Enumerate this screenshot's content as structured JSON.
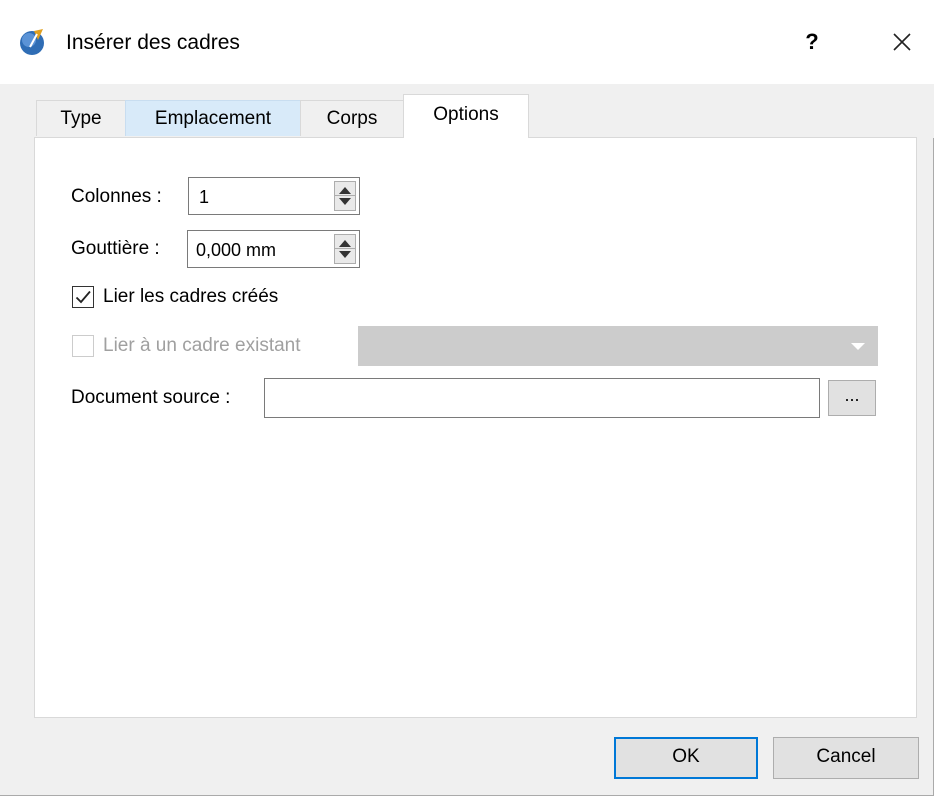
{
  "window": {
    "title": "Insérer des cadres",
    "help_label": "?"
  },
  "tabs": [
    {
      "label": "Type",
      "state": "normal"
    },
    {
      "label": "Emplacement",
      "state": "hover"
    },
    {
      "label": "Corps",
      "state": "normal"
    },
    {
      "label": "Options",
      "state": "active"
    }
  ],
  "options": {
    "columns_label": "Colonnes :",
    "columns_value": "1",
    "gutter_label": "Gouttière :",
    "gutter_value": "0,000 mm",
    "link_created_label": "Lier les cadres créés",
    "link_created_checked": true,
    "link_existing_label": "Lier à un cadre existant",
    "link_existing_checked": false,
    "link_existing_enabled": false,
    "link_existing_selected": "",
    "source_label": "Document source :",
    "source_value": "",
    "browse_label": "..."
  },
  "buttons": {
    "ok_label": "OK",
    "cancel_label": "Cancel"
  },
  "colors": {
    "accent": "#0078d7",
    "tab_hover": "#d8eaf9",
    "disabled_text": "#a0a0a0",
    "icon_blue": "#2f6db5"
  },
  "icons": {
    "app": "scribus-pen-icon",
    "close": "close-icon",
    "check": "checkmark-icon",
    "dropdown": "chevron-down-icon"
  }
}
